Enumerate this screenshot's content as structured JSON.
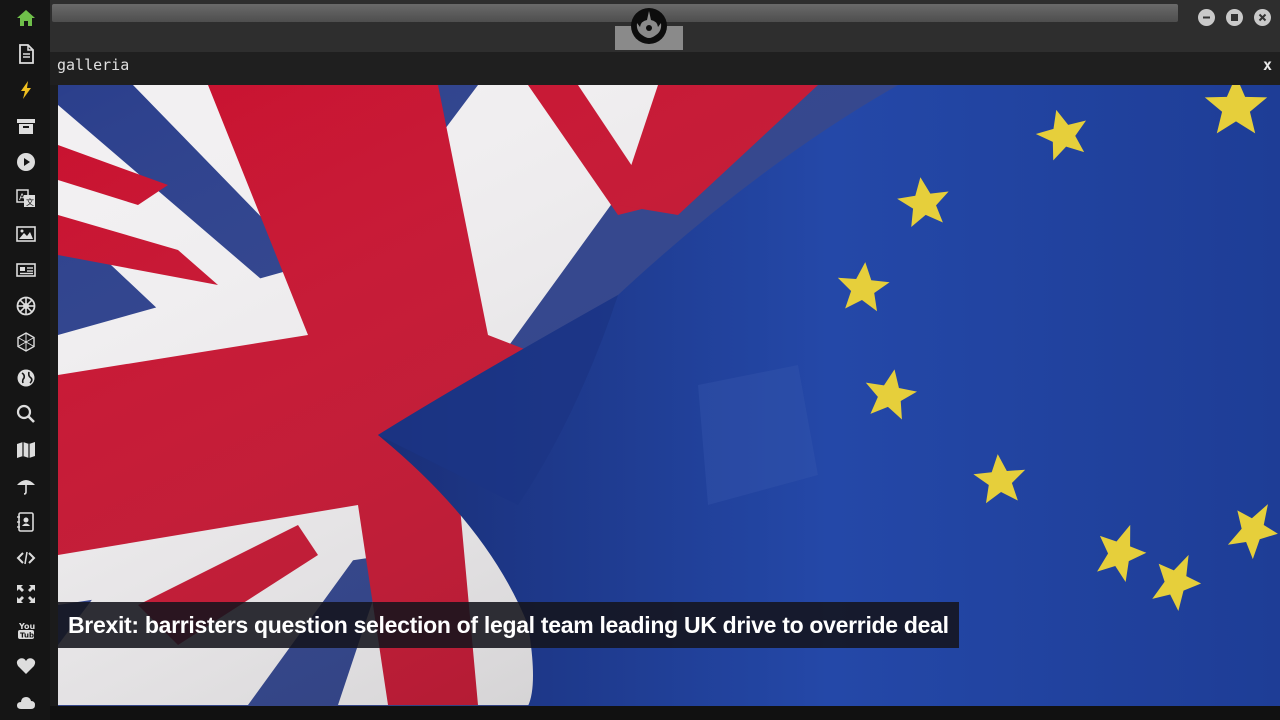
{
  "sidebar": {
    "items": [
      {
        "icon": "home-icon",
        "color": "#6fbf4a"
      },
      {
        "icon": "document-icon"
      },
      {
        "icon": "lightning-icon"
      },
      {
        "icon": "archive-icon"
      },
      {
        "icon": "play-icon"
      },
      {
        "icon": "translate-icon"
      },
      {
        "icon": "image-icon"
      },
      {
        "icon": "newspaper-icon"
      },
      {
        "icon": "galactic-empire-icon"
      },
      {
        "icon": "hexagon-icon"
      },
      {
        "icon": "globe-icon"
      },
      {
        "icon": "search-icon"
      },
      {
        "icon": "map-icon"
      },
      {
        "icon": "umbrella-icon"
      },
      {
        "icon": "contacts-icon"
      },
      {
        "icon": "code-icon"
      },
      {
        "icon": "expand-icon"
      },
      {
        "icon": "youtube-icon"
      },
      {
        "icon": "heart-icon"
      },
      {
        "icon": "cloud-icon"
      }
    ]
  },
  "window": {
    "logo": "rebel-alliance-icon",
    "controls": [
      "minimize-icon",
      "maximize-icon",
      "close-icon"
    ]
  },
  "panel": {
    "title": "galleria",
    "close_label": "x"
  },
  "gallery": {
    "caption": "Brexit: barristers question selection of legal team leading UK drive to override deal"
  },
  "colors": {
    "uk_red": "#c8102e",
    "uk_blue": "#2b3f8c",
    "eu_blue": "#1f3f9a",
    "eu_star": "#e6cf3b",
    "accent_green": "#6fbf4a"
  }
}
